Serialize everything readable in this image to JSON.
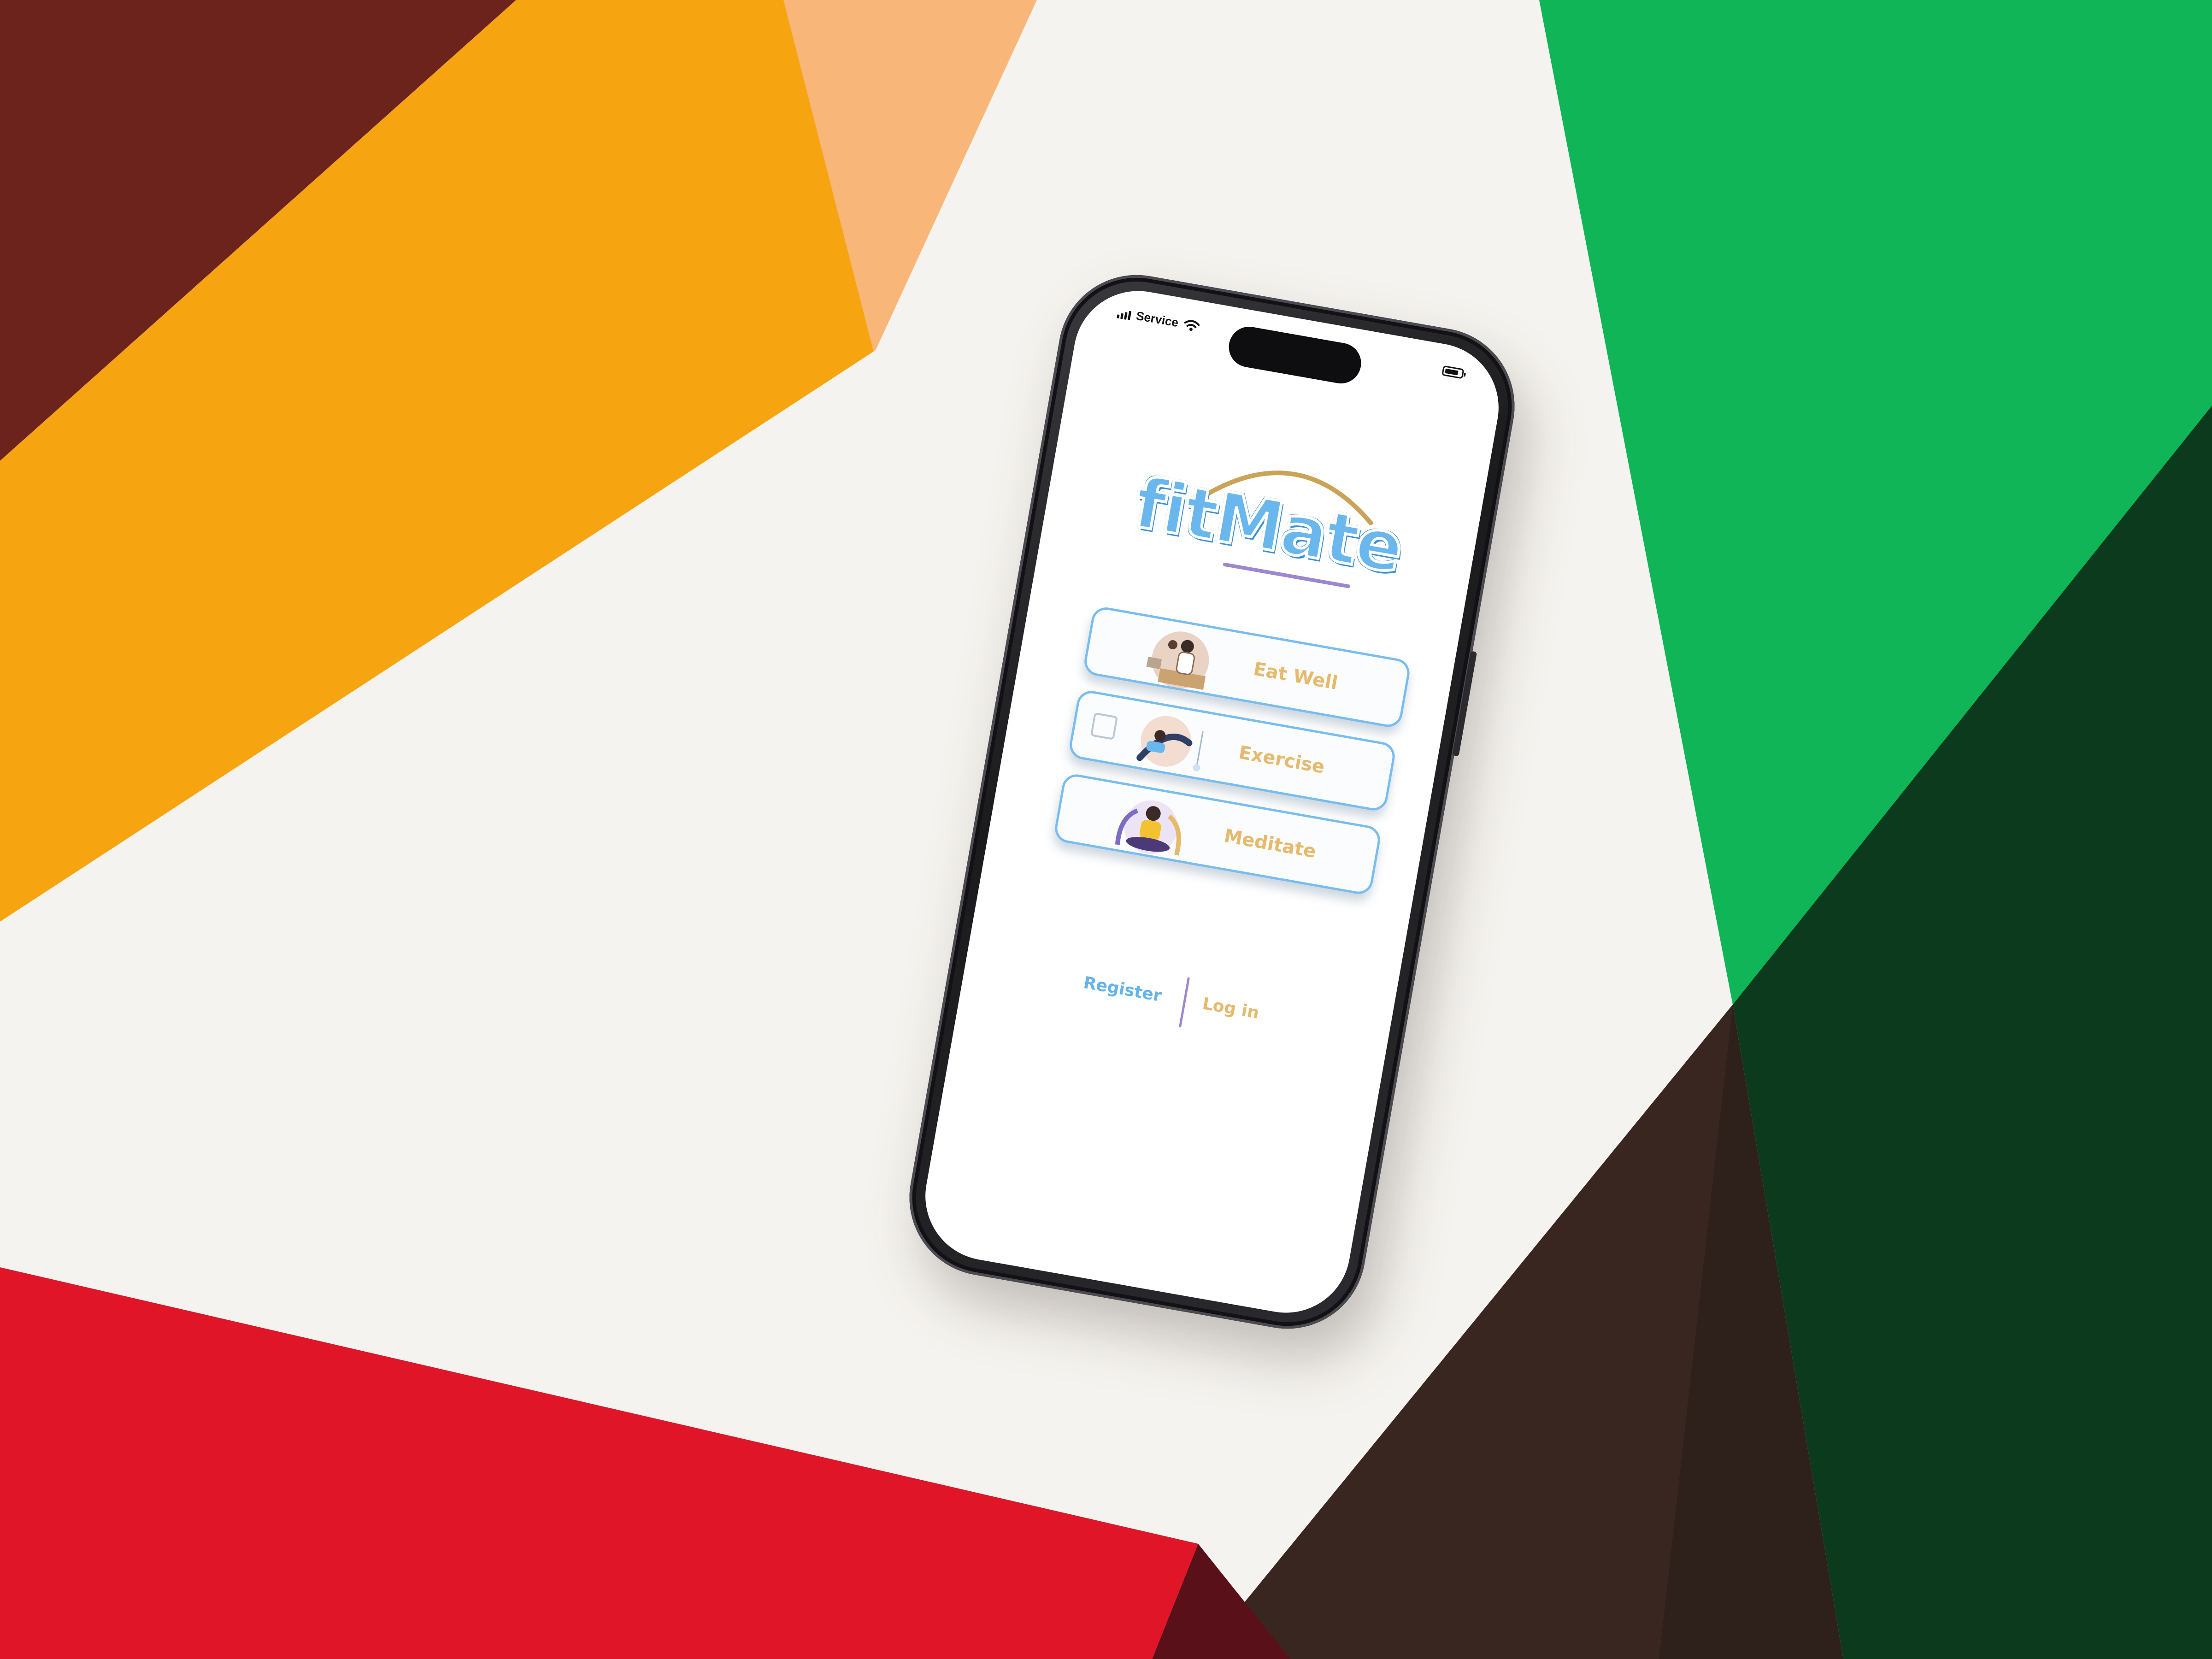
{
  "status_bar": {
    "carrier": "Service"
  },
  "app": {
    "logo_text": "fitMate",
    "menu": [
      {
        "label": "Eat Well",
        "icon": "eating-illustration"
      },
      {
        "label": "Exercise",
        "icon": "exercise-illustration"
      },
      {
        "label": "Meditate",
        "icon": "meditation-illustration"
      }
    ],
    "auth": {
      "register": "Register",
      "login": "Log in"
    }
  },
  "colors": {
    "accent_blue": "#6ab7ee",
    "accent_gold": "#e6ba6d",
    "accent_purple": "#9c87cf"
  }
}
